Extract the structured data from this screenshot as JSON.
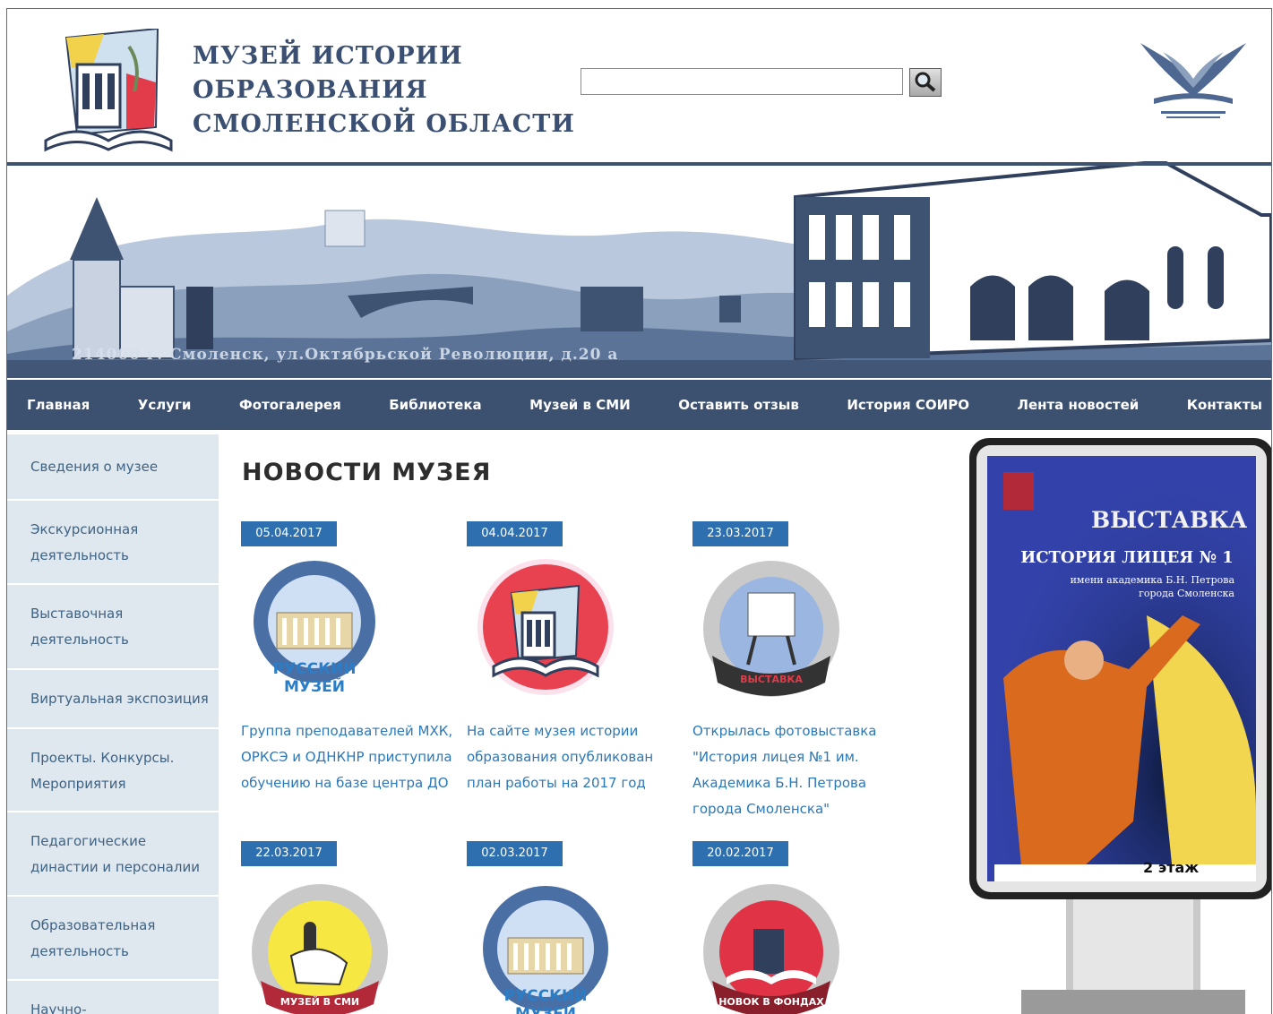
{
  "header": {
    "title_lines": [
      "МУЗЕЙ ИСТОРИИ",
      "ОБРАЗОВАНИЯ",
      "СМОЛЕНСКОЙ ОБЛАСТИ"
    ],
    "address": "214000 г. Смоленск, ул.Октябрьской Революции, д.20 а",
    "search": {
      "value": "",
      "placeholder": "",
      "button_icon": "search-icon"
    }
  },
  "nav": {
    "items": [
      "Главная",
      "Услуги",
      "Фотогалерея",
      "Библиотека",
      "Музей в СМИ",
      "Оставить отзыв",
      "История СОИРО",
      "Лента новостей",
      "Контакты"
    ]
  },
  "sidebar": {
    "items": [
      [
        "Сведения о музее"
      ],
      [
        "Экскурсионная",
        "деятельность"
      ],
      [
        "Выставочная",
        "деятельность"
      ],
      [
        "Виртуальная экспозиция"
      ],
      [
        "Проекты. Конкурсы.",
        "Мероприятия"
      ],
      [
        "Педагогические",
        "династии и персоналии"
      ],
      [
        "Образовательная",
        "деятельность"
      ],
      [
        "Научно-"
      ]
    ]
  },
  "main": {
    "title": "НОВОСТИ МУЗЕЯ",
    "news": [
      {
        "date": "05.04.2017",
        "text": "Группа преподавателей МХК, ОРКСЭ и ОДНКНР приступила обучению на базе центра ДО",
        "image": "russian-museum-badge"
      },
      {
        "date": "04.04.2017",
        "text": "На сайте музея истории образования опубликован план работы на 2017 год",
        "image": "museum-logo-badge"
      },
      {
        "date": "23.03.2017",
        "text": "Открылась фотовыставка \"История лицея №1 им. Академика Б.Н. Петрова города Смоленска\"",
        "image": "exhibition-badge"
      },
      {
        "date": "22.03.2017",
        "text": "",
        "image": "museum-in-media-badge"
      },
      {
        "date": "02.03.2017",
        "text": "",
        "image": "russian-museum-badge"
      },
      {
        "date": "20.02.2017",
        "text": "",
        "image": "new-in-collection-badge"
      }
    ],
    "badge_texts": {
      "russian_museum": [
        "РУССКИЙ",
        "МУЗЕЙ"
      ],
      "exhibition": "ВЫСТАВКА",
      "media": "МУЗЕЙ В СМИ",
      "new_items": "НОВОК В ФОНДАХ"
    }
  },
  "poster": {
    "title_1": "ВЫСТАВКА",
    "title_2": "ИСТОРИЯ ЛИЦЕЯ № 1",
    "sub_1": "имени академика Б.Н. Петрова",
    "sub_2": "города Смоленска",
    "floor": "2 этаж"
  },
  "colors": {
    "nav": "#3c5070",
    "accent": "#2d6faf",
    "sidebar": "#dfe7ef",
    "link": "#2b78b8"
  }
}
